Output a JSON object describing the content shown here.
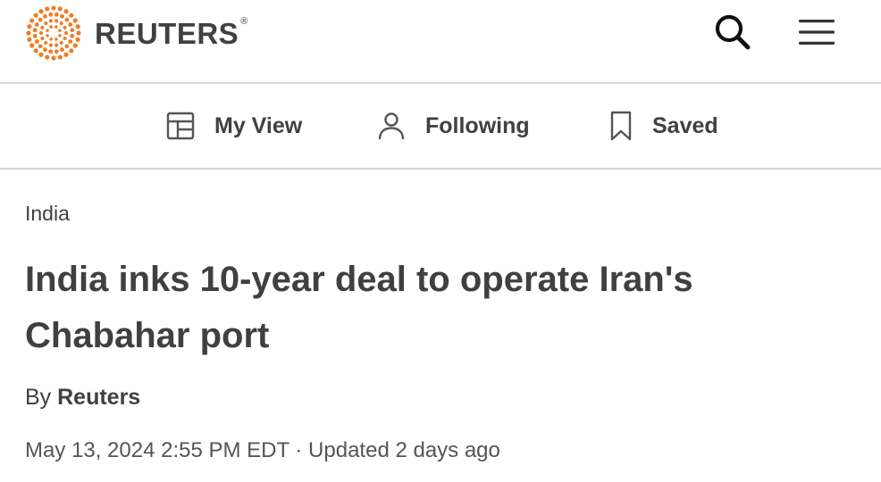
{
  "header": {
    "brand": "REUTERS",
    "brand_mark": "®",
    "logo_icon": "reuters-dot-ring-logo",
    "logo_color": "#f07c26",
    "search_icon": "search-icon",
    "menu_icon": "hamburger-menu-icon"
  },
  "subnav": {
    "items": [
      {
        "label": "My View",
        "icon": "layout-grid-icon"
      },
      {
        "label": "Following",
        "icon": "person-icon"
      },
      {
        "label": "Saved",
        "icon": "bookmark-icon"
      }
    ]
  },
  "article": {
    "section": "India",
    "headline": "India inks 10-year deal to operate Iran's Chabahar port",
    "byline_prefix": "By ",
    "author": "Reuters",
    "published": "May 13, 2024 2:55 PM EDT",
    "separator": " · ",
    "updated": "Updated 2 days ago"
  },
  "colors": {
    "text": "#404040",
    "divider": "#d6d6d6",
    "brand_orange": "#f07c26"
  }
}
